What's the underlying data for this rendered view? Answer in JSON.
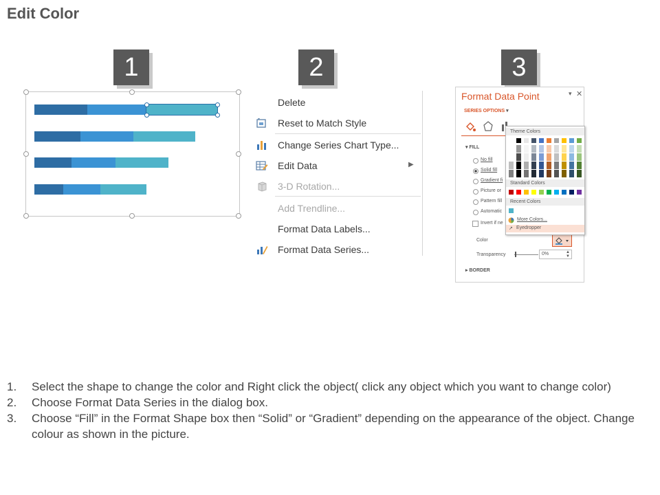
{
  "page": {
    "title": "Edit Color"
  },
  "steps": [
    "1",
    "2",
    "3"
  ],
  "chart": {
    "colors": [
      "#2e6da4",
      "#3b93d4",
      "#4fb3c9"
    ],
    "bars": [
      [
        24,
        27,
        32
      ],
      [
        21,
        24,
        28
      ],
      [
        17,
        20,
        24
      ],
      [
        13,
        17,
        21
      ]
    ]
  },
  "context_menu": {
    "items": [
      {
        "label": "Delete",
        "icon": "none",
        "disabled": false
      },
      {
        "label": "Reset to Match Style",
        "icon": "reset-style-icon",
        "disabled": false
      },
      {
        "label": "Change Series Chart Type...",
        "icon": "bar-chart-icon",
        "disabled": false
      },
      {
        "label": "Edit Data",
        "icon": "edit-data-icon",
        "disabled": false,
        "submenu": true
      },
      {
        "label": "3-D Rotation...",
        "icon": "cube-icon",
        "disabled": true
      },
      {
        "label": "Add Trendline...",
        "icon": "none",
        "disabled": true
      },
      {
        "label": "Format Data Labels...",
        "icon": "none",
        "disabled": false
      },
      {
        "label": "Format Data Series...",
        "icon": "format-series-icon",
        "disabled": false
      }
    ]
  },
  "format_pane": {
    "title": "Format Data Point",
    "series_options": "SERIES OPTIONS",
    "fill_section": "FILL",
    "fill_options": [
      "No fill",
      "Solid fill",
      "Gradient fi",
      "Picture or",
      "Pattern fill",
      "Automatic",
      "Invert if ne"
    ],
    "color_label": "Color",
    "transparency_label": "Transparency",
    "transparency_value": "0%",
    "border_section": "BORDER",
    "accent_color": "#d9562a",
    "palette": {
      "theme_colors": "Theme Colors",
      "standard_colors": "Standard Colors",
      "recent_colors": "Recent Colors",
      "more_colors": "More Colors...",
      "eyedropper": "Eyedropper",
      "theme_swatches": [
        "#ffffff",
        "#000000",
        "#e7e6e6",
        "#44546a",
        "#4472c4",
        "#ed7d31",
        "#a5a5a5",
        "#ffc000",
        "#5b9bd5",
        "#70ad47"
      ],
      "standard_swatches": [
        "#c00000",
        "#ff0000",
        "#ffc000",
        "#ffff00",
        "#92d050",
        "#00b050",
        "#00b0f0",
        "#0070c0",
        "#002060",
        "#7030a0"
      ]
    }
  },
  "instructions": [
    {
      "num": "1.",
      "text": "Select the shape to change the color and Right click the object( click any object which you want to change color)"
    },
    {
      "num": "2.",
      "text": "Choose Format Data Series in the dialog box."
    },
    {
      "num": "3.",
      "text": "Choose “Fill” in the Format Shape box then “Solid” or “Gradient” depending on the appearance of the object. Change colour as shown in the picture."
    }
  ]
}
